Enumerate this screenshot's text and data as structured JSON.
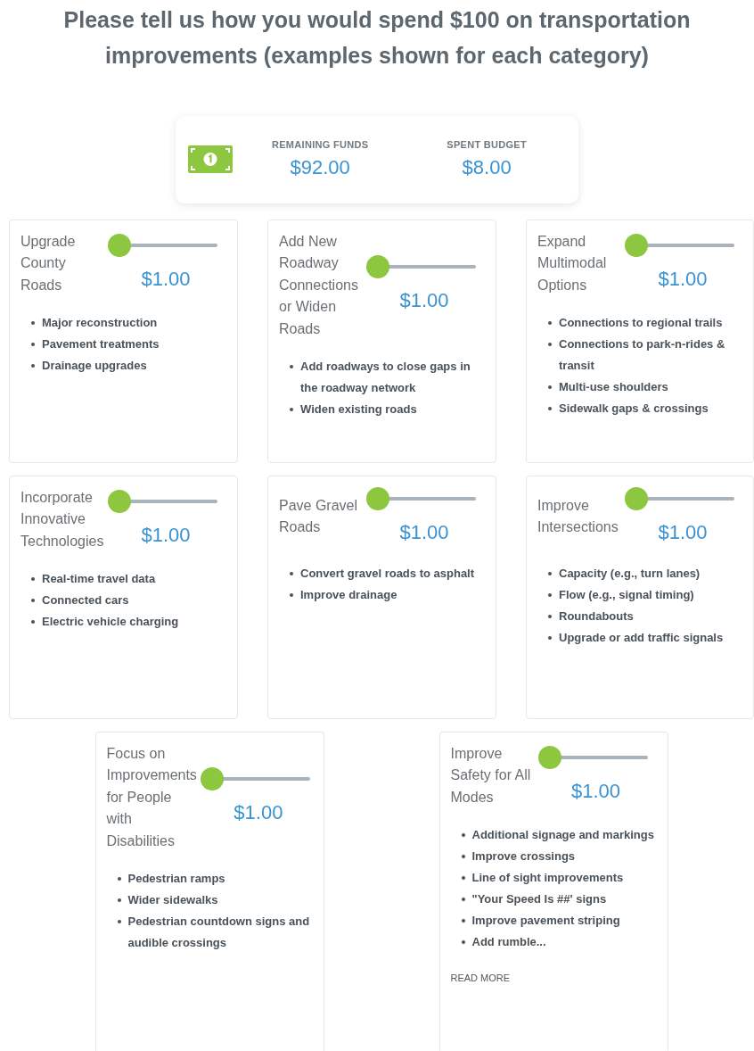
{
  "heading": "Please tell us how you would spend $100 on transportation improvements (examples shown for each category)",
  "summary": {
    "stats": [
      {
        "label": "REMAINING FUNDS",
        "value": "$92.00"
      },
      {
        "label": "SPENT BUDGET",
        "value": "$8.00"
      }
    ]
  },
  "categories": [
    {
      "title": "Upgrade County Roads",
      "level": 0,
      "amount": "$1.00",
      "examples": [
        "Major reconstruction",
        "Pavement treatments",
        "Drainage upgrades"
      ]
    },
    {
      "title": "Add New Roadway Connections or Widen Roads",
      "level": 0,
      "amount": "$1.00",
      "examples": [
        "Add roadways to close gaps in the roadway network",
        "Widen existing roads"
      ]
    },
    {
      "title": "Expand Multimodal Options",
      "level": 0,
      "amount": "$1.00",
      "examples": [
        "Connections to regional trails",
        "Connections to park-n-rides & transit",
        "Multi-use shoulders",
        "Sidewalk gaps & crossings"
      ]
    },
    {
      "title": "Incorporate Innovative Technologies",
      "level": 0,
      "amount": "$1.00",
      "examples": [
        "Real-time travel data",
        "Connected cars",
        "Electric vehicle charging"
      ]
    },
    {
      "title": "Pave Gravel Roads",
      "level": 0,
      "amount": "$1.00",
      "examples": [
        "Convert gravel roads to asphalt",
        "Improve drainage"
      ]
    },
    {
      "title": "Improve Intersections",
      "level": 0,
      "amount": "$1.00",
      "examples": [
        "Capacity (e.g., turn lanes)",
        "Flow (e.g., signal timing)",
        "Roundabouts",
        "Upgrade or add traffic signals"
      ]
    },
    {
      "title": "Focus on Improvements for People with Disabilities",
      "level": 0,
      "amount": "$1.00",
      "examples": [
        "Pedestrian ramps",
        "Wider sidewalks",
        "Pedestrian countdown signs and audible crossings"
      ]
    },
    {
      "title": "Improve Safety for All Modes",
      "level": 0,
      "amount": "$1.00",
      "examples": [
        "Additional signage and markings",
        "Improve crossings",
        "Line of sight improvements",
        "\"Your Speed Is ##' signs",
        "Improve pavement striping",
        "Add rumble..."
      ],
      "read_more": "READ MORE"
    }
  ]
}
